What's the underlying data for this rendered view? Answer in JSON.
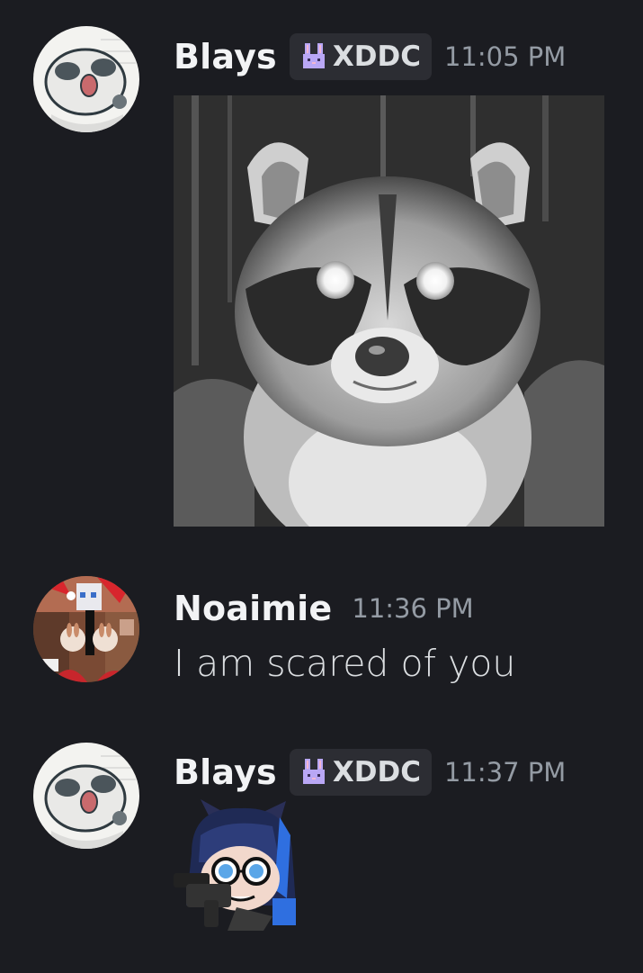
{
  "messages": [
    {
      "author": "Blays",
      "tag": "XDDC",
      "tag_icon": "bunny-icon",
      "timestamp": "11:05 PM",
      "attachment": "raccoon-image"
    },
    {
      "author": "Noaimie",
      "timestamp": "11:36 PM",
      "text": "I am scared of you"
    },
    {
      "author": "Blays",
      "tag": "XDDC",
      "tag_icon": "bunny-icon",
      "timestamp": "11:37 PM",
      "attachment": "sticker"
    }
  ],
  "colors": {
    "background": "#1b1c21",
    "username": "#f2f3f5",
    "timestamp": "#949ba4",
    "tag_background": "#2c2d33",
    "message_text": "#dbdee1",
    "tag_icon": "#b9a7f5"
  }
}
